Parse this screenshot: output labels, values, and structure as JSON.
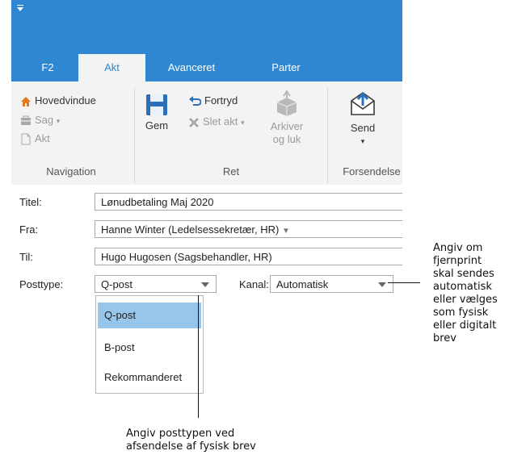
{
  "tabs": [
    {
      "label": "F2",
      "active": false
    },
    {
      "label": "Akt",
      "active": true
    },
    {
      "label": "Avanceret",
      "active": false
    },
    {
      "label": "Parter",
      "active": false
    }
  ],
  "ribbon": {
    "navigation": {
      "label": "Navigation",
      "hovedvindue": "Hovedvindue",
      "sag": "Sag",
      "akt": "Akt"
    },
    "ret": {
      "label": "Ret",
      "gem": "Gem",
      "fortryd": "Fortryd",
      "slet_akt": "Slet akt",
      "arkiver_line1": "Arkiver",
      "arkiver_line2": "og luk"
    },
    "forsendelse": {
      "label": "Forsendelse",
      "send": "Send"
    }
  },
  "form": {
    "titel_label": "Titel:",
    "titel_value": "Lønudbetaling Maj 2020",
    "fra_label": "Fra:",
    "fra_value": "Hanne Winter (Ledelsessekretær, HR)",
    "til_label": "Til:",
    "til_value": "Hugo Hugosen (Sagsbehandler, HR)",
    "posttype_label": "Posttype:",
    "posttype_value": "Q-post",
    "kanal_label": "Kanal:",
    "kanal_value": "Automatisk"
  },
  "posttype_options": [
    "Q-post",
    "B-post",
    "Rekommanderet"
  ],
  "selected_option": "Q-post",
  "callouts": {
    "kanal": [
      "Angiv om",
      "fjernprint",
      "skal sendes",
      "automatisk",
      "eller vælges",
      "som fysisk",
      "eller digitalt",
      "brev"
    ],
    "posttype": [
      "Angiv posttypen ved",
      "afsendelse af fysisk brev"
    ]
  },
  "colors": {
    "titlebar": "#2f87d1",
    "ribbon": "#f3f3f3",
    "selected_option": "#98c5ea"
  }
}
